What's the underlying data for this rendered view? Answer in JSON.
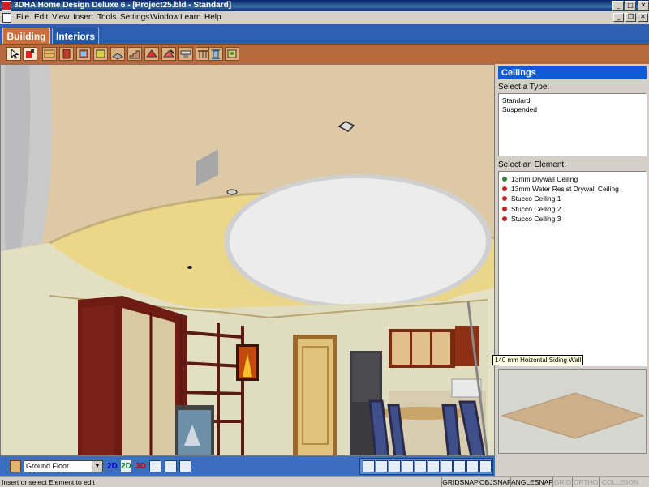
{
  "window": {
    "title": "3DHA Home Design Deluxe 6 - [Project25.bld - Standard]",
    "buttons": [
      "_",
      "□",
      "✕"
    ],
    "mdi_buttons": [
      "_",
      "❐",
      "✕"
    ]
  },
  "menu": [
    "File",
    "Edit",
    "View",
    "Insert",
    "Tools",
    "Settings",
    "Window",
    "Learn",
    "Help"
  ],
  "mode_tabs": {
    "active": "Building",
    "items": [
      "Building",
      "Interiors"
    ]
  },
  "toolbar": {
    "tools": [
      "select-tool-icon",
      "paint-tool-icon",
      "wall-tool-icon",
      "door-tool-icon",
      "window-tool-icon",
      "opening-tool-icon",
      "floor-tool-icon",
      "stair-tool-icon",
      "roof-tool-icon",
      "roof-edit-tool-icon",
      "ceiling-tool-icon",
      "railing-tool-icon",
      "column-tool-icon",
      "landscape-tool-icon"
    ]
  },
  "panel": {
    "header": "Ceilings",
    "type_label": "Select a Type:",
    "types": [
      "Standard",
      "Suspended"
    ],
    "element_label": "Select an Element:",
    "elements": [
      {
        "name": "13mm Drywall Ceiling",
        "color": "#2e8b2e"
      },
      {
        "name": "13mm Water Resist Drywall Ceiling",
        "color": "#cc2222"
      },
      {
        "name": "Stucco Ceiling 1",
        "color": "#cc2222"
      },
      {
        "name": "Stucco Ceiling 2",
        "color": "#cc2222"
      },
      {
        "name": "Stucco Ceiling 3",
        "color": "#cc2222"
      }
    ]
  },
  "tooltip": "140 mm Hoizontal Siding Wall",
  "bottom": {
    "floor": "Ground Floor",
    "view_buttons": [
      {
        "label": "2D",
        "color": "#0000cc"
      },
      {
        "label": "2D",
        "color": "#0a7a2a"
      },
      {
        "label": "3D",
        "color": "#cc0000"
      }
    ],
    "nav_icons": [
      "zoom-window-icon",
      "zoom-fit-icon",
      "zoom-in-icon",
      "pan-icon",
      "walk-icon",
      "camera-icon",
      "rotate-icon",
      "orbit-icon",
      "fly-icon",
      "snapshot-icon"
    ]
  },
  "status": {
    "text": "Insert or select Element to edit",
    "snaps": [
      {
        "label": "GRIDSNAP",
        "on": true
      },
      {
        "label": "OBJSNAP",
        "on": true
      },
      {
        "label": "ANGLESNAP",
        "on": true
      },
      {
        "label": "GRID",
        "on": false
      },
      {
        "label": "ORTHO",
        "on": false
      },
      {
        "label": "COLLISION",
        "on": false
      }
    ]
  }
}
